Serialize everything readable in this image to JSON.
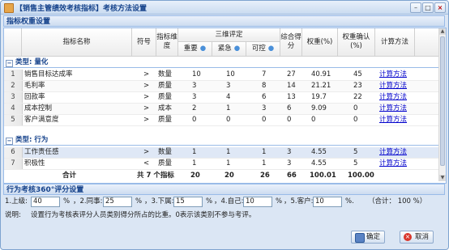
{
  "window": {
    "title": "【销售主管绩效考核指标】考核方法设置",
    "minimize_glyph": "–",
    "maximize_glyph": "□",
    "close_glyph": "×"
  },
  "weights_section": {
    "title": "指标权重设置"
  },
  "grid": {
    "headers": {
      "name": "指标名称",
      "symbol": "符号",
      "dimension": "指标维度",
      "three_dim": "三维评定",
      "importance": "重要",
      "urgency": "紧急",
      "control": "可控",
      "score": "综合得分",
      "weight": "权重(%)",
      "weight_confirm": "权重确认(%)",
      "method": "计算方法"
    },
    "groups": [
      {
        "label": "类型: 量化",
        "rows": [
          {
            "no": "1",
            "name": "销售目标达成率",
            "symbol": ">",
            "dimension": "数量",
            "importance": "10",
            "urgency": "10",
            "control": "7",
            "score": "27",
            "weight": "40.91",
            "confirm": "45",
            "method": "计算方法"
          },
          {
            "no": "2",
            "name": "毛利率",
            "symbol": ">",
            "dimension": "质量",
            "importance": "3",
            "urgency": "3",
            "control": "8",
            "score": "14",
            "weight": "21.21",
            "confirm": "23",
            "method": "计算方法"
          },
          {
            "no": "3",
            "name": "回款率",
            "symbol": ">",
            "dimension": "质量",
            "importance": "3",
            "urgency": "4",
            "control": "6",
            "score": "13",
            "weight": "19.7",
            "confirm": "22",
            "method": "计算方法"
          },
          {
            "no": "4",
            "name": "成本控制",
            "symbol": ">",
            "dimension": "成本",
            "importance": "2",
            "urgency": "1",
            "control": "3",
            "score": "6",
            "weight": "9.09",
            "confirm": "0",
            "method": "计算方法"
          },
          {
            "no": "5",
            "name": "客户满意度",
            "symbol": ">",
            "dimension": "质量",
            "importance": "0",
            "urgency": "0",
            "control": "0",
            "score": "0",
            "weight": "0",
            "confirm": "0",
            "method": "计算方法"
          }
        ]
      },
      {
        "label": "类型: 行为",
        "rows": [
          {
            "no": "6",
            "name": "工作责任感",
            "symbol": ">",
            "dimension": "数量",
            "importance": "1",
            "urgency": "1",
            "control": "1",
            "score": "3",
            "weight": "4.55",
            "confirm": "5",
            "method": "计算方法"
          },
          {
            "no": "7",
            "name": "积极性",
            "symbol": "<",
            "dimension": "质量",
            "importance": "1",
            "urgency": "1",
            "control": "1",
            "score": "3",
            "weight": "4.55",
            "confirm": "5",
            "method": "计算方法"
          }
        ]
      }
    ],
    "total": {
      "label": "合计",
      "count": "共 7 个指标",
      "importance": "20",
      "urgency": "20",
      "control": "26",
      "score": "66",
      "weight": "100.01",
      "confirm": "100.00"
    }
  },
  "eval360": {
    "title": "行为考核360°评分设置",
    "superior_label": "1.上级:",
    "superior_value": "40",
    "peer_label": "，2.同事:",
    "peer_value": "25",
    "sub_label": "，3.下属:",
    "sub_value": "15",
    "self_label": "，4.自己:",
    "self_value": "10",
    "client_label": "，5.客户:",
    "client_value": "10",
    "percent": "%",
    "percent_dot": "%.",
    "sum_text": "（合计： 100 %）",
    "note_label": "说明:",
    "note_text": "设置行为考核表评分人员类别得分所占的比重。0表示该类别不参与考评。"
  },
  "buttons": {
    "ok": "确定",
    "cancel": "取消"
  },
  "colors": {
    "accent": "#15428b",
    "link": "#0000cc",
    "border": "#99bbe8"
  }
}
